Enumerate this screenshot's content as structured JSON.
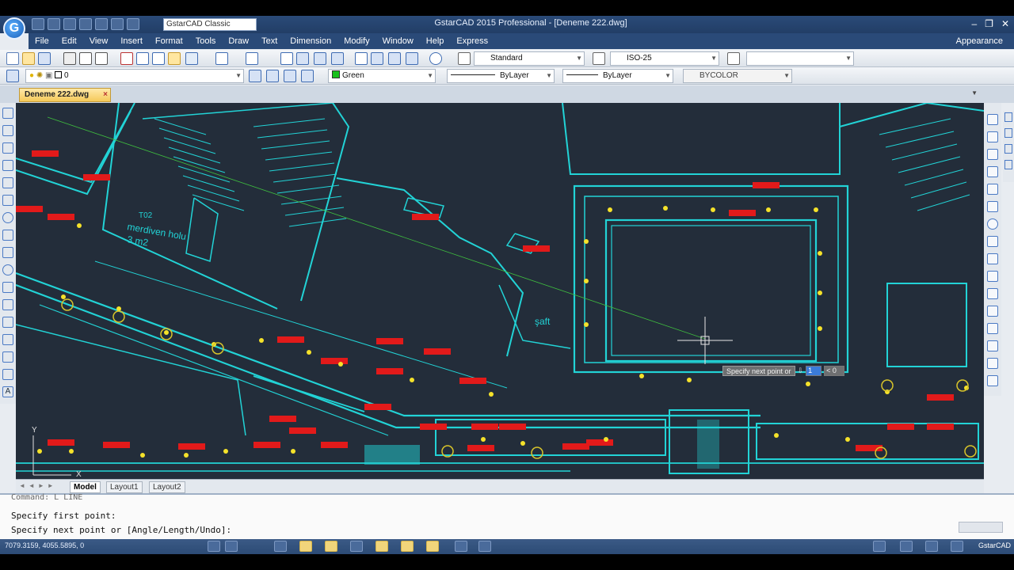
{
  "window": {
    "title": "GstarCAD 2015 Professional - [Deneme 222.dwg]",
    "logo_letter": "G",
    "workspace": "GstarCAD Classic",
    "controls": [
      "–",
      "❐",
      "✕"
    ]
  },
  "menu": {
    "items": [
      "File",
      "Edit",
      "View",
      "Insert",
      "Format",
      "Tools",
      "Draw",
      "Text",
      "Dimension",
      "Modify",
      "Window",
      "Help",
      "Express"
    ],
    "right": "Appearance"
  },
  "toolbar": {
    "text_style": "Standard",
    "dim_style": "ISO-25",
    "layer": "0",
    "color": "Green",
    "color_hex": "#19c01c",
    "linetype": "ByLayer",
    "lineweight": "ByLayer",
    "plotstyle": "BYCOLOR"
  },
  "document": {
    "tab": "Deneme 222.dwg"
  },
  "canvas": {
    "background": "#232d3a",
    "room_labels": {
      "stair": "merdiven holu",
      "stair_area": "3 m2",
      "room_number": "T02",
      "shaft": "şaft"
    },
    "tooltip": {
      "prompt": "Specify next point or",
      "length": "1",
      "angle": "< 0"
    },
    "ucs": {
      "y": "Y",
      "x": "X"
    }
  },
  "layouts": {
    "tabs": [
      "Model",
      "Layout1",
      "Layout2"
    ],
    "active": "Model"
  },
  "command": {
    "history": "Command: L LINE",
    "line1": "Specify first point:",
    "line2": "Specify next point or [Angle/Length/Undo]:"
  },
  "status": {
    "coords": "7079.3159, 4055.5895, 0",
    "brand": "GstarCAD"
  }
}
